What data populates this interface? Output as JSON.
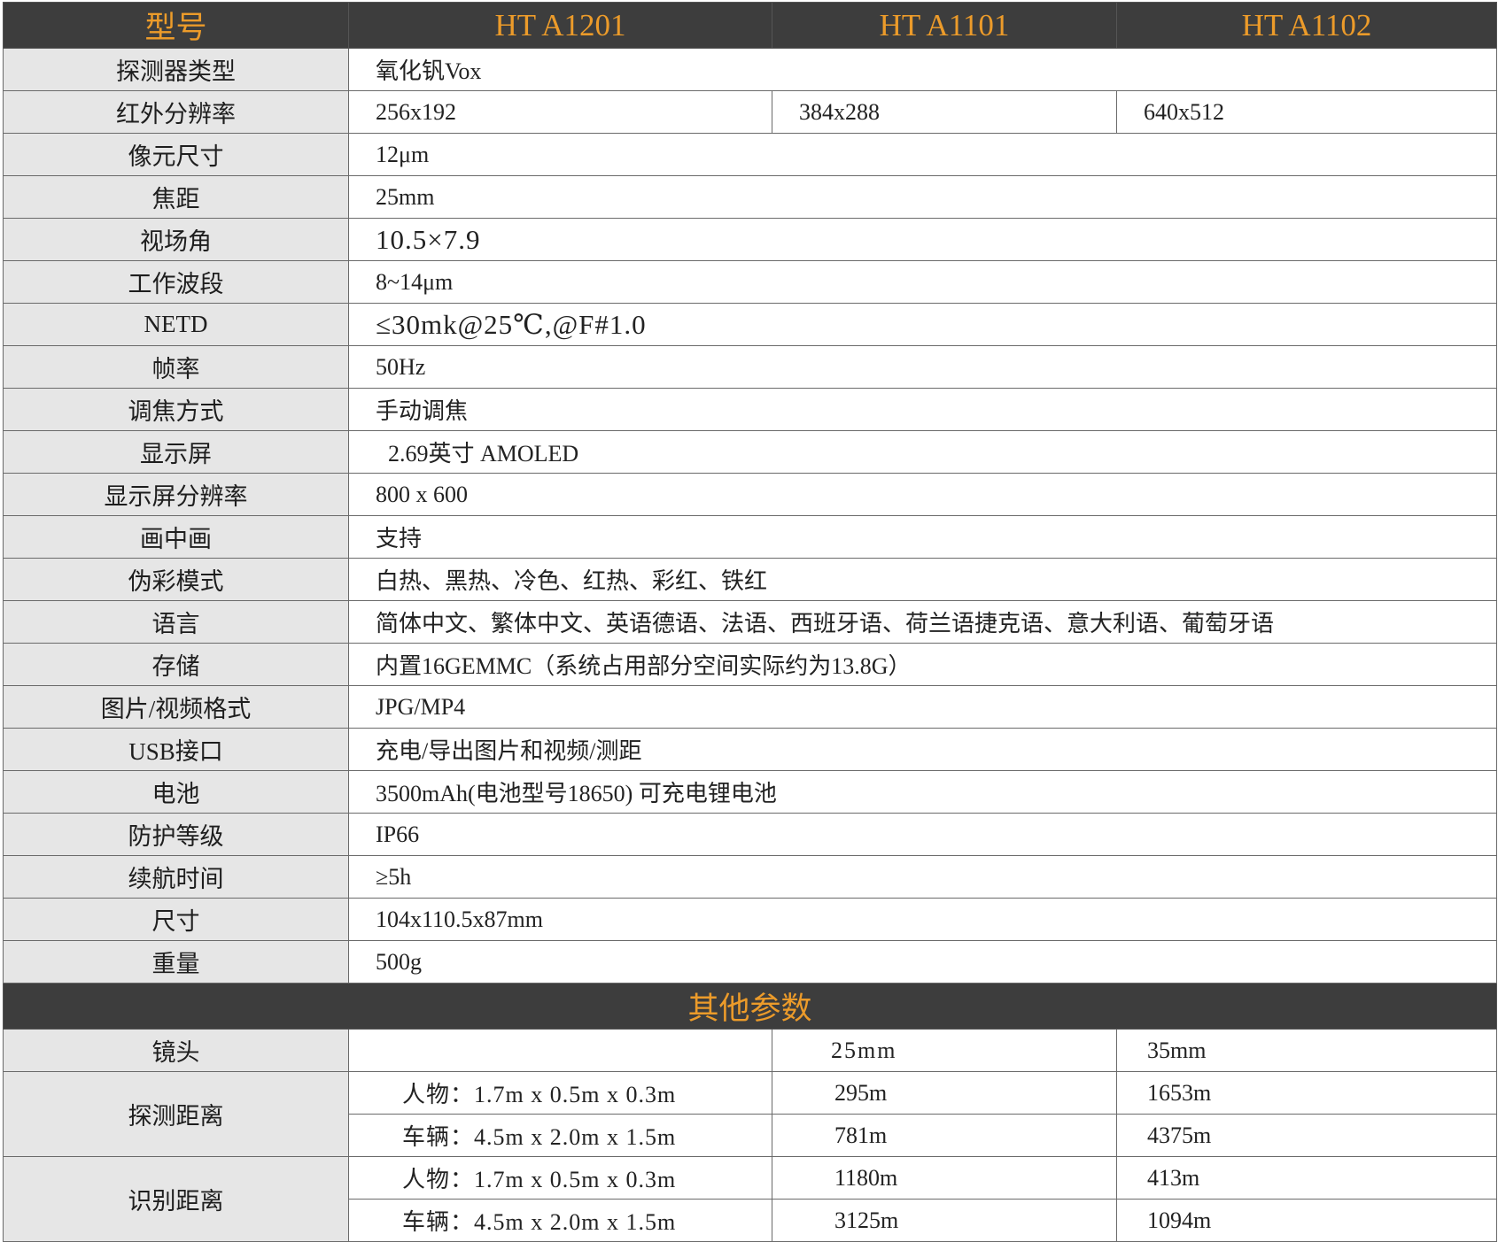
{
  "header": {
    "label": "型号",
    "models": [
      "HT A1201",
      "HT A1101",
      "HT A1102"
    ]
  },
  "specs": {
    "detector": {
      "label": "探测器类型",
      "value": "氧化钒Vox"
    },
    "resolution": {
      "label": "红外分辨率",
      "values": [
        "256x192",
        "384x288",
        "640x512"
      ]
    },
    "pixel": {
      "label": "像元尺寸",
      "value": "12μm"
    },
    "focal": {
      "label": "焦距",
      "value": "25mm"
    },
    "fov": {
      "label": "视场角",
      "value": "10.5×7.9"
    },
    "band": {
      "label": "工作波段",
      "value": "8~14μm"
    },
    "netd": {
      "label": "NETD",
      "value": "≤30mk@25℃,@F#1.0"
    },
    "framerate": {
      "label": "帧率",
      "value": "50Hz"
    },
    "focus": {
      "label": "调焦方式",
      "value": "手动调焦"
    },
    "display": {
      "label": "显示屏",
      "value": "2.69英寸 AMOLED"
    },
    "display_res": {
      "label": "显示屏分辨率",
      "value": "800 x 600"
    },
    "pip": {
      "label": "画中画",
      "value": "支持"
    },
    "palette": {
      "label": "伪彩模式",
      "value": "白热、黑热、冷色、红热、彩红、铁红"
    },
    "language": {
      "label": "语言",
      "value": "简体中文、繁体中文、英语德语、法语、西班牙语、荷兰语捷克语、意大利语、葡萄牙语"
    },
    "storage": {
      "label": "存储",
      "value": "内置16GEMMC（系统占用部分空间实际约为13.8G）"
    },
    "format": {
      "label": "图片/视频格式",
      "value": "JPG/MP4"
    },
    "usb": {
      "label": "USB接口",
      "value": "充电/导出图片和视频/测距"
    },
    "battery": {
      "label": "电池",
      "value": "3500mAh(电池型号18650) 可充电锂电池"
    },
    "ip": {
      "label": "防护等级",
      "value": "IP66"
    },
    "endurance": {
      "label": "续航时间",
      "value": "≥5h"
    },
    "size": {
      "label": "尺寸",
      "value": "104x110.5x87mm"
    },
    "weight": {
      "label": "重量",
      "value": "500g"
    }
  },
  "other": {
    "title": "其他参数",
    "lens": {
      "label": "镜头",
      "values": [
        "",
        "25mm",
        "35mm"
      ]
    },
    "detection": {
      "label": "探测距离",
      "rows": [
        {
          "target": "人物：1.7m x 0.5m x 0.3m",
          "values": [
            "295m",
            "1653m"
          ]
        },
        {
          "target": "车辆：4.5m x 2.0m x 1.5m",
          "values": [
            "781m",
            "4375m"
          ]
        }
      ]
    },
    "recognition": {
      "label": "识别距离",
      "rows": [
        {
          "target": "人物：1.7m x 0.5m x 0.3m",
          "values": [
            "1180m",
            "413m"
          ]
        },
        {
          "target": "车辆：4.5m x 2.0m x 1.5m",
          "values": [
            "3125m",
            "1094m"
          ]
        }
      ]
    }
  },
  "colors": {
    "header_bg": "#3d3d3d",
    "header_text": "#ec9b2a",
    "label_bg": "#e6e6e6",
    "border": "#6a6a6a"
  }
}
